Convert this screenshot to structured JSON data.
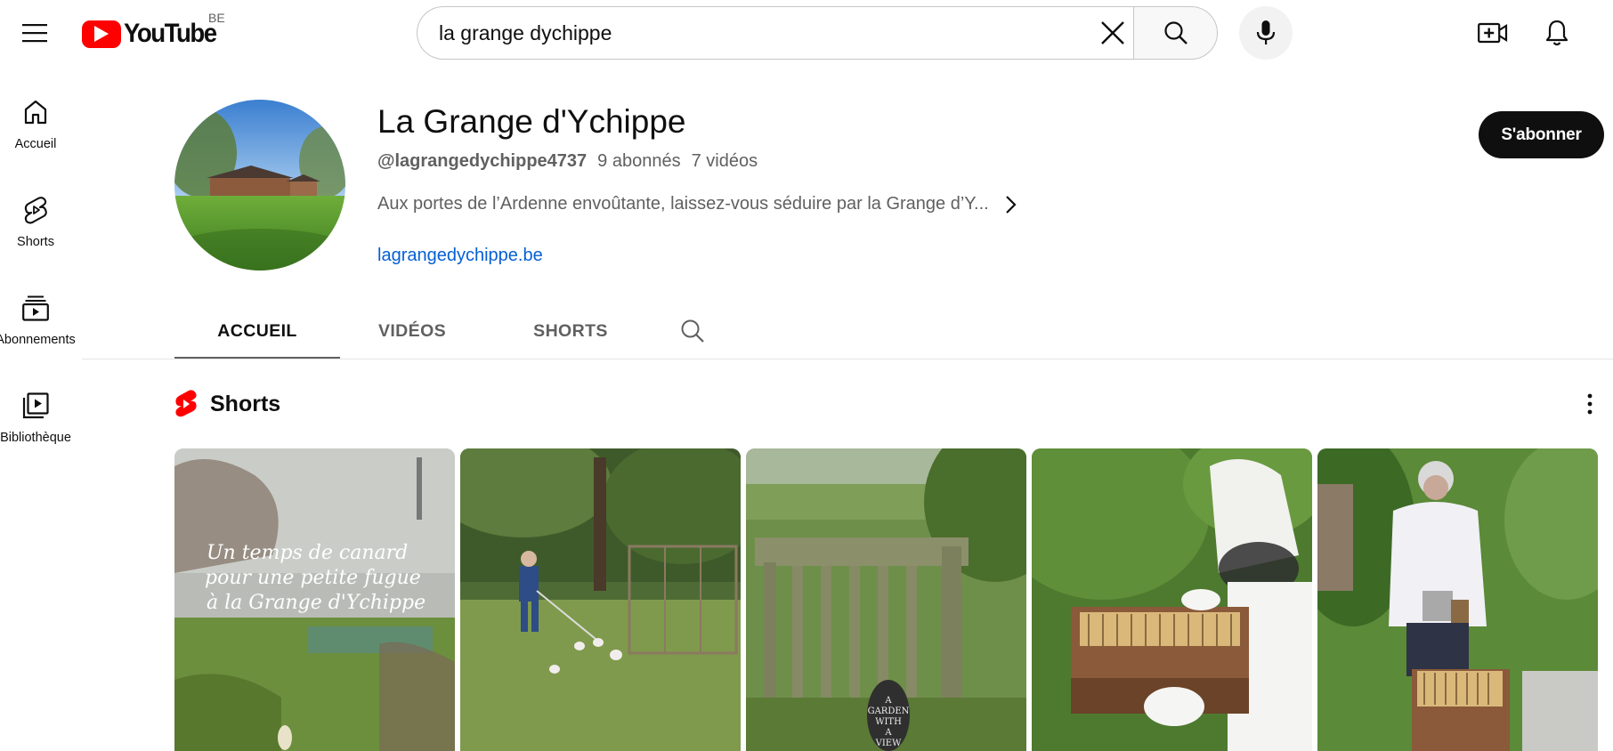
{
  "topbar": {
    "logo_text": "YouTube",
    "country_code": "BE",
    "search_value": "la grange dychippe"
  },
  "sidebar": {
    "items": [
      {
        "label": "Accueil",
        "icon": "home-icon"
      },
      {
        "label": "Shorts",
        "icon": "shorts-icon"
      },
      {
        "label": "Abonnements",
        "icon": "subscriptions-icon"
      },
      {
        "label": "Bibliothèque",
        "icon": "library-icon"
      }
    ]
  },
  "channel": {
    "name": "La Grange d'Ychippe",
    "handle": "@lagrangedychippe4737",
    "subscribers": "9 abonnés",
    "videos": "7 vidéos",
    "description": "Aux portes de l’Ardenne envoûtante, laissez-vous séduire par la Grange d’Y...",
    "link": "lagrangedychippe.be",
    "subscribe_label": "S'abonner"
  },
  "tabs": [
    {
      "label": "ACCUEIL",
      "active": true
    },
    {
      "label": "VIDÉOS",
      "active": false
    },
    {
      "label": "SHORTS",
      "active": false
    }
  ],
  "shorts": {
    "title": "Shorts",
    "items": [
      {
        "overlay_lines": [
          "Un temps de canard",
          "pour une petite fugue",
          "à la Grange d'Ychippe"
        ]
      },
      {
        "overlay_lines": []
      },
      {
        "overlay_lines": [],
        "sign_lines": [
          "A",
          "GARDEN",
          "WITH",
          "A",
          "VIEW"
        ]
      },
      {
        "overlay_lines": []
      },
      {
        "overlay_lines": []
      }
    ]
  },
  "colors": {
    "brand_red": "#ff0000",
    "link_blue": "#065fd4",
    "subscribe_bg": "#0f0f0f",
    "secondary_text": "#606060"
  }
}
